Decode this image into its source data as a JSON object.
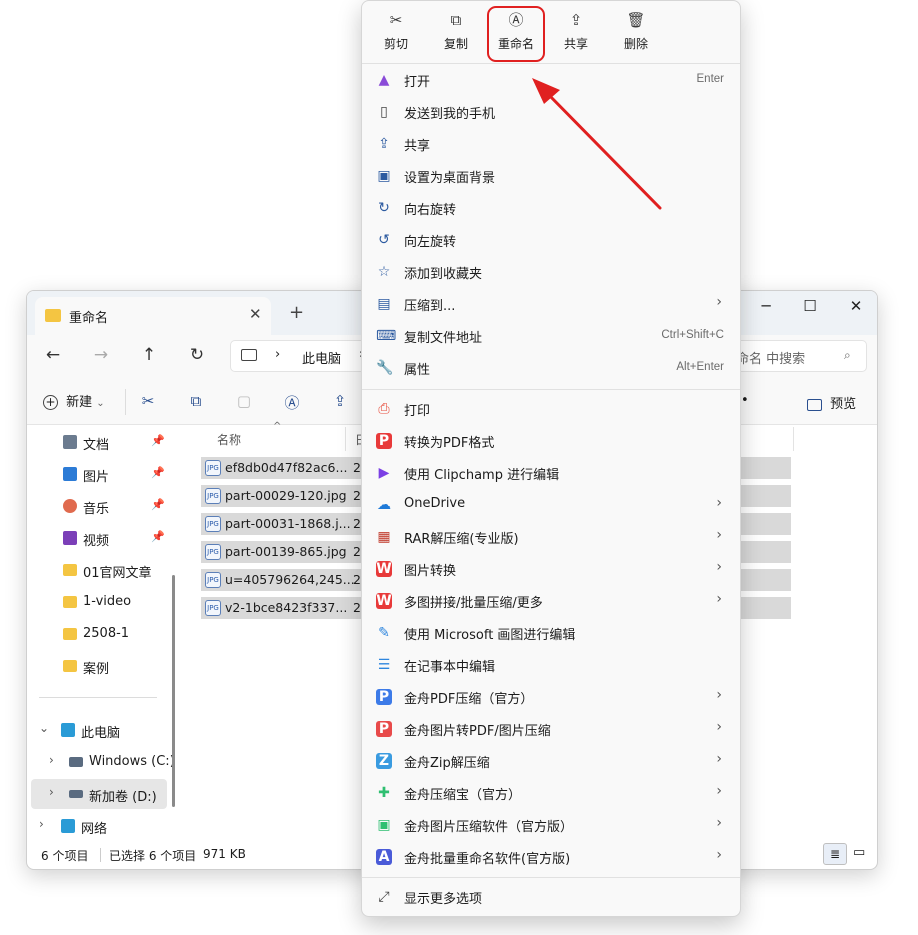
{
  "explorer": {
    "tab_title": "重命名",
    "tab_close": "✕",
    "tab_add": "+",
    "window_controls": {
      "minimize": "─",
      "maximize": "☐",
      "close": "✕"
    },
    "nav": {
      "back": "←",
      "forward": "→",
      "up": "↑",
      "refresh": "↻"
    },
    "address": {
      "crumb_sep": "›",
      "path": "此电脑",
      "crumb_more": "›"
    },
    "search_placeholder": "命名 中搜索",
    "toolbar": {
      "new_label": "新建",
      "new_chevron": "⌄",
      "more": "•",
      "preview_label": "预览"
    },
    "sidebar": {
      "quick_items": [
        {
          "label": "文档",
          "pinned": true
        },
        {
          "label": "图片",
          "pinned": true
        },
        {
          "label": "音乐",
          "pinned": true
        },
        {
          "label": "视频",
          "pinned": true
        },
        {
          "label": "01官网文章",
          "pinned": false
        },
        {
          "label": "1-video",
          "pinned": false
        },
        {
          "label": "2508-1",
          "pinned": false
        },
        {
          "label": "案例",
          "pinned": false
        }
      ],
      "this_pc": "此电脑",
      "drive_c": "Windows (C:)",
      "drive_d": "新加卷 (D:)",
      "network": "网络",
      "pin_glyph": "📌",
      "chevron_open": "⌄",
      "chevron_closed": "›"
    },
    "columns": {
      "name": "名称",
      "date": "日",
      "sort_glyph": "^"
    },
    "files": [
      {
        "name": "ef8db0d47f82ac6...",
        "date": "20"
      },
      {
        "name": "part-00029-120.jpg",
        "date": "20"
      },
      {
        "name": "part-00031-1868.j...",
        "date": "20"
      },
      {
        "name": "part-00139-865.jpg",
        "date": "20"
      },
      {
        "name": "u=405796264,245...",
        "date": "20"
      },
      {
        "name": "v2-1bce8423f337...",
        "date": "20"
      }
    ],
    "file_icon_label": "JPG",
    "status": {
      "count": "6 个项目",
      "selected": "已选择 6 个项目",
      "size": "971 KB"
    }
  },
  "context_menu": {
    "quick_actions": [
      {
        "label": "剪切",
        "icon": "✂"
      },
      {
        "label": "复制",
        "icon": "⧉"
      },
      {
        "label": "重命名",
        "icon": "Ⓐ"
      },
      {
        "label": "共享",
        "icon": "⇪"
      },
      {
        "label": "删除",
        "icon": "🗑"
      }
    ],
    "group1": [
      {
        "label": "打开",
        "shortcut": "Enter",
        "icon": "▲",
        "color": "#8a4bd8"
      },
      {
        "label": "发送到我的手机",
        "shortcut": "",
        "icon": "▯",
        "color": "#444444"
      },
      {
        "label": "共享",
        "shortcut": "",
        "icon": "⇪",
        "color": "#2c5aa0"
      },
      {
        "label": "设置为桌面背景",
        "shortcut": "",
        "icon": "▣",
        "color": "#2c5aa0"
      },
      {
        "label": "向右旋转",
        "shortcut": "",
        "icon": "↻",
        "color": "#2c5aa0"
      },
      {
        "label": "向左旋转",
        "shortcut": "",
        "icon": "↺",
        "color": "#2c5aa0"
      },
      {
        "label": "添加到收藏夹",
        "shortcut": "",
        "icon": "☆",
        "color": "#2c5aa0"
      },
      {
        "label": "压缩到...",
        "shortcut": "",
        "icon": "▤",
        "color": "#2c5aa0",
        "submenu": true
      },
      {
        "label": "复制文件地址",
        "shortcut": "Ctrl+Shift+C",
        "icon": "⌨",
        "color": "#2c5aa0"
      },
      {
        "label": "属性",
        "shortcut": "Alt+Enter",
        "icon": "🔧",
        "color": "#555555"
      }
    ],
    "group2": [
      {
        "label": "打印",
        "icon": "⎙",
        "color": "#e74c3c",
        "submenu": false
      },
      {
        "label": "转换为PDF格式",
        "icon": "P",
        "color": "#e83a3a",
        "submenu": false
      },
      {
        "label": "使用 Clipchamp 进行编辑",
        "icon": "▶",
        "color": "#7b3fe4",
        "submenu": false
      },
      {
        "label": "OneDrive",
        "icon": "☁",
        "color": "#1f7ad8",
        "submenu": true
      },
      {
        "label": "RAR解压缩(专业版)",
        "icon": "▦",
        "color": "#c0392b",
        "submenu": true
      },
      {
        "label": "图片转换",
        "icon": "W",
        "color": "#e83a3a",
        "submenu": true
      },
      {
        "label": "多图拼接/批量压缩/更多",
        "icon": "W",
        "color": "#e83a3a",
        "submenu": true
      },
      {
        "label": "使用 Microsoft 画图进行编辑",
        "icon": "✎",
        "color": "#2e86de",
        "submenu": false
      },
      {
        "label": "在记事本中编辑",
        "icon": "☰",
        "color": "#2e86de",
        "submenu": false
      },
      {
        "label": "金舟PDF压缩（官方）",
        "icon": "P",
        "color": "#3d7be8",
        "submenu": true
      },
      {
        "label": "金舟图片转PDF/图片压缩",
        "icon": "P",
        "color": "#e84a4a",
        "submenu": true
      },
      {
        "label": "金舟Zip解压缩",
        "icon": "Z",
        "color": "#3a9be0",
        "submenu": true
      },
      {
        "label": "金舟压缩宝（官方）",
        "icon": "✚",
        "color": "#2fbf71",
        "submenu": true
      },
      {
        "label": "金舟图片压缩软件（官方版）",
        "icon": "▣",
        "color": "#2fbf71",
        "submenu": true
      },
      {
        "label": "金舟批量重命名软件(官方版)",
        "icon": "A",
        "color": "#4a5bd8",
        "submenu": true
      }
    ],
    "more_options": {
      "label": "显示更多选项",
      "icon": "⤢"
    },
    "arrow_glyph": "›"
  },
  "colors": {
    "annotation_red": "#e02020",
    "accent": "#2c5aa0",
    "folder": "#f4c542"
  }
}
